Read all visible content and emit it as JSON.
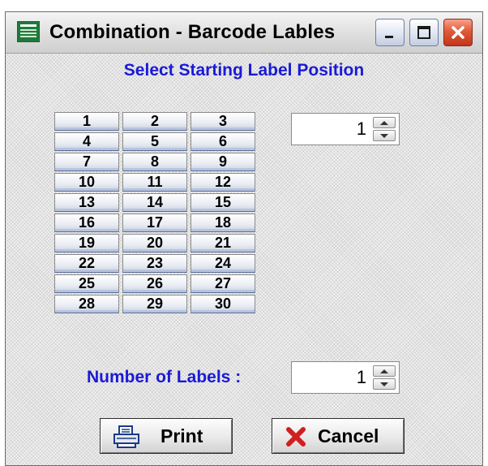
{
  "window": {
    "title": "Combination - Barcode Lables",
    "icon": "app-window-icon",
    "controls": [
      "minimize-icon",
      "maximize-icon",
      "close-icon"
    ]
  },
  "heading": "Select Starting Label Position",
  "label_positions": [
    "1",
    "2",
    "3",
    "4",
    "5",
    "6",
    "7",
    "8",
    "9",
    "10",
    "11",
    "12",
    "13",
    "14",
    "15",
    "16",
    "17",
    "18",
    "19",
    "20",
    "21",
    "22",
    "23",
    "24",
    "25",
    "26",
    "27",
    "28",
    "29",
    "30"
  ],
  "start_position": {
    "value": "1"
  },
  "number_of_labels": {
    "label": "Number of Labels :",
    "value": "1"
  },
  "buttons": {
    "print": {
      "label": "Print",
      "icon": "printer-icon"
    },
    "cancel": {
      "label": "Cancel",
      "icon": "red-x-icon"
    }
  },
  "colors": {
    "heading_blue": "#1a1ad6",
    "close_red": "#e05a38",
    "cancel_red": "#d11f1f"
  }
}
